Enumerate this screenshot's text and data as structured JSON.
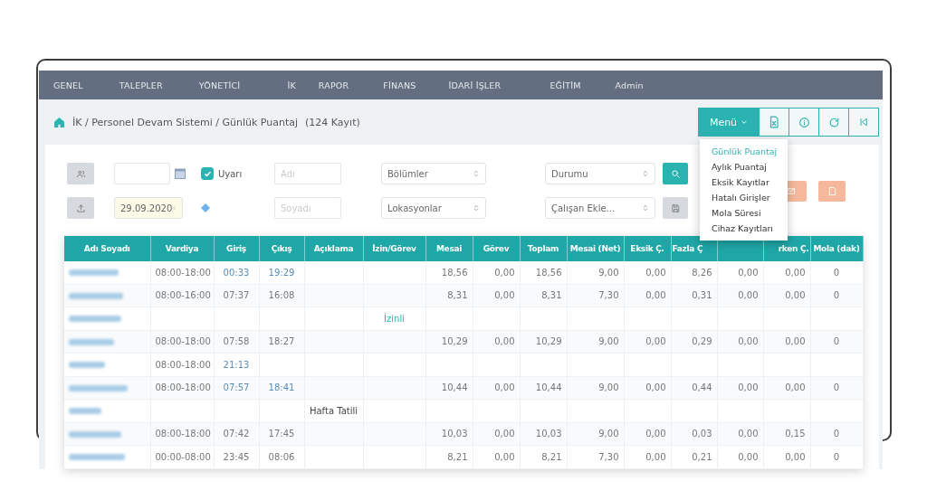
{
  "nav": [
    "GENEL",
    "TALEPLER",
    "YÖNETİCİ",
    "İK",
    "RAPOR",
    "FİNANS",
    "İDARİ İŞLER",
    "EĞİTİM",
    "Admin"
  ],
  "breadcrumb": {
    "path": "İK / Personel Devam Sistemi / Günlük Puantaj",
    "count": "(124 Kayıt)"
  },
  "toolbar": {
    "menu_label": "Menü",
    "menu_expanded": true
  },
  "menu": [
    {
      "label": "Günlük Puantaj",
      "selected": true
    },
    {
      "label": "Aylık Puantaj",
      "selected": false
    },
    {
      "label": "Eksik Kayıtlar",
      "selected": false
    },
    {
      "label": "Hatalı Girişler",
      "selected": false
    },
    {
      "label": "Mola Süresi",
      "selected": false
    },
    {
      "label": "Cihaz Kayıtları",
      "selected": false
    }
  ],
  "filters": {
    "warning": {
      "label": "Uyarı",
      "checked": true
    },
    "date": "29.09.2020",
    "first_name_placeholder": "Adı",
    "last_name_placeholder": "Soyadı",
    "departments": "Bölümler",
    "locations": "Lokasyonlar",
    "status": "Durumu",
    "add_employee": "Çalışan Ekle..."
  },
  "table": {
    "columns": [
      {
        "label": "Adı Soyadı"
      },
      {
        "label": "Vardiya"
      },
      {
        "label": "Giriş"
      },
      {
        "label": "Çıkış"
      },
      {
        "label": "Açıklama"
      },
      {
        "label": "İzin/Görev"
      },
      {
        "label": "Mesai"
      },
      {
        "label": "Görev"
      },
      {
        "label": "Toplam"
      },
      {
        "label": "Mesai (Net)"
      },
      {
        "label": "Eksik Ç."
      },
      {
        "label": "Fazla Ç"
      },
      {},
      {
        "label": "rken Ç."
      },
      {
        "label": "Mola (dak)"
      }
    ],
    "rows": [
      {
        "times_flagged": true,
        "cells": [
          "",
          "08:00-18:00",
          "00:33",
          "19:29",
          "",
          "",
          "18,56",
          "0,00",
          "18,56",
          "9,00",
          "0,00",
          "8,26",
          "0,00",
          "0,00",
          "0"
        ]
      },
      {
        "times_flagged": false,
        "cells": [
          "",
          "08:00-16:00",
          "07:37",
          "16:08",
          "",
          "",
          "8,31",
          "0,00",
          "8,31",
          "7,30",
          "0,00",
          "0,31",
          "0,00",
          "0,00",
          "0"
        ]
      },
      {
        "cells": [
          "",
          "",
          "",
          "",
          "",
          "İzinli",
          "",
          "",
          "",
          "",
          "",
          "",
          "",
          "",
          ""
        ]
      },
      {
        "times_flagged": false,
        "cells": [
          "",
          "08:00-18:00",
          "07:58",
          "18:27",
          "",
          "",
          "10,29",
          "0,00",
          "10,29",
          "9,00",
          "0,00",
          "0,29",
          "0,00",
          "0,00",
          "0"
        ]
      },
      {
        "times_flagged": true,
        "cells": [
          "",
          "08:00-18:00",
          "21:13",
          "",
          "",
          "",
          "",
          "",
          "",
          "",
          "",
          "",
          "",
          "",
          ""
        ]
      },
      {
        "times_flagged": true,
        "cells": [
          "",
          "08:00-18:00",
          "07:57",
          "18:41",
          "",
          "",
          "10,44",
          "0,00",
          "10,44",
          "9,00",
          "0,00",
          "0,44",
          "0,00",
          "0,00",
          "0"
        ]
      },
      {
        "cells": [
          "",
          "",
          "",
          "",
          "Hafta Tatili",
          "",
          "",
          "",
          "",
          "",
          "",
          "",
          "",
          "",
          ""
        ]
      },
      {
        "times_flagged": false,
        "cells": [
          "",
          "08:00-18:00",
          "07:42",
          "17:45",
          "",
          "",
          "10,03",
          "0,00",
          "10,03",
          "9,00",
          "0,00",
          "0,03",
          "0,00",
          "0,15",
          "0"
        ]
      },
      {
        "times_flagged": false,
        "cells": [
          "",
          "00:00-08:00",
          "23:45",
          "08:06",
          "",
          "",
          "8,21",
          "0,00",
          "8,21",
          "7,30",
          "0,00",
          "0,21",
          "0,00",
          "0,00",
          "0"
        ]
      }
    ]
  }
}
